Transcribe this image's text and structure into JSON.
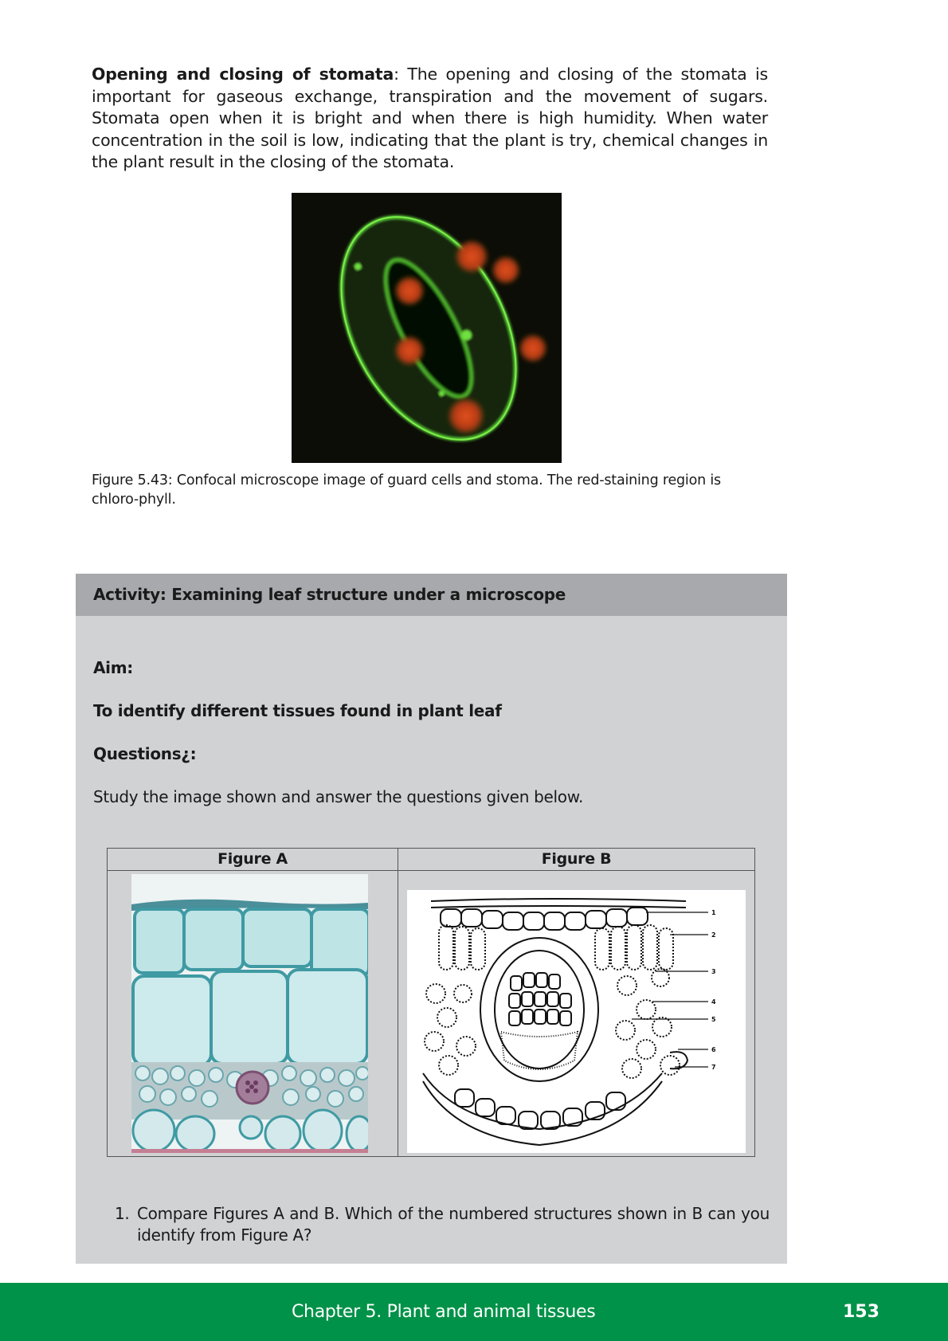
{
  "intro": {
    "heading": "Opening and closing of stomata",
    "separator": ":",
    "body": " The opening and closing of the stomata is important for gaseous exchange, transpiration and the movement of sugars. Stomata open when it is bright and when there is high humidity.  When water concentration in the soil is low, indicating that the plant is try, chemical changes in the plant result in the closing of the stomata."
  },
  "figure": {
    "caption": "Figure 5.43: Confocal microscope image of guard cells and stoma. The red-staining region is chloro-phyll."
  },
  "activity": {
    "title": "Activity:  Examining leaf structure under a microscope",
    "aim_label": "Aim:",
    "aim_text": "To identify different tissues found in plant leaf",
    "questions_label": "Questions¿:",
    "instruction": "Study the image shown and answer the questions given below.",
    "figure_a_label": "Figure A",
    "figure_b_label": "Figure B",
    "diagram_labels": [
      "1",
      "2",
      "3",
      "4",
      "5",
      "6",
      "7"
    ],
    "questions": [
      {
        "number": "1.",
        "text": "Compare Figures A and B. Which of the numbered structures shown in B can you identify from Figure A?"
      }
    ]
  },
  "footer": {
    "chapter": "Chapter 5.   Plant and animal tissues",
    "page": "153",
    "color": "#009248"
  },
  "colors": {
    "activity_bg": "#d1d2d4",
    "activity_header": "#a7a9ac"
  }
}
